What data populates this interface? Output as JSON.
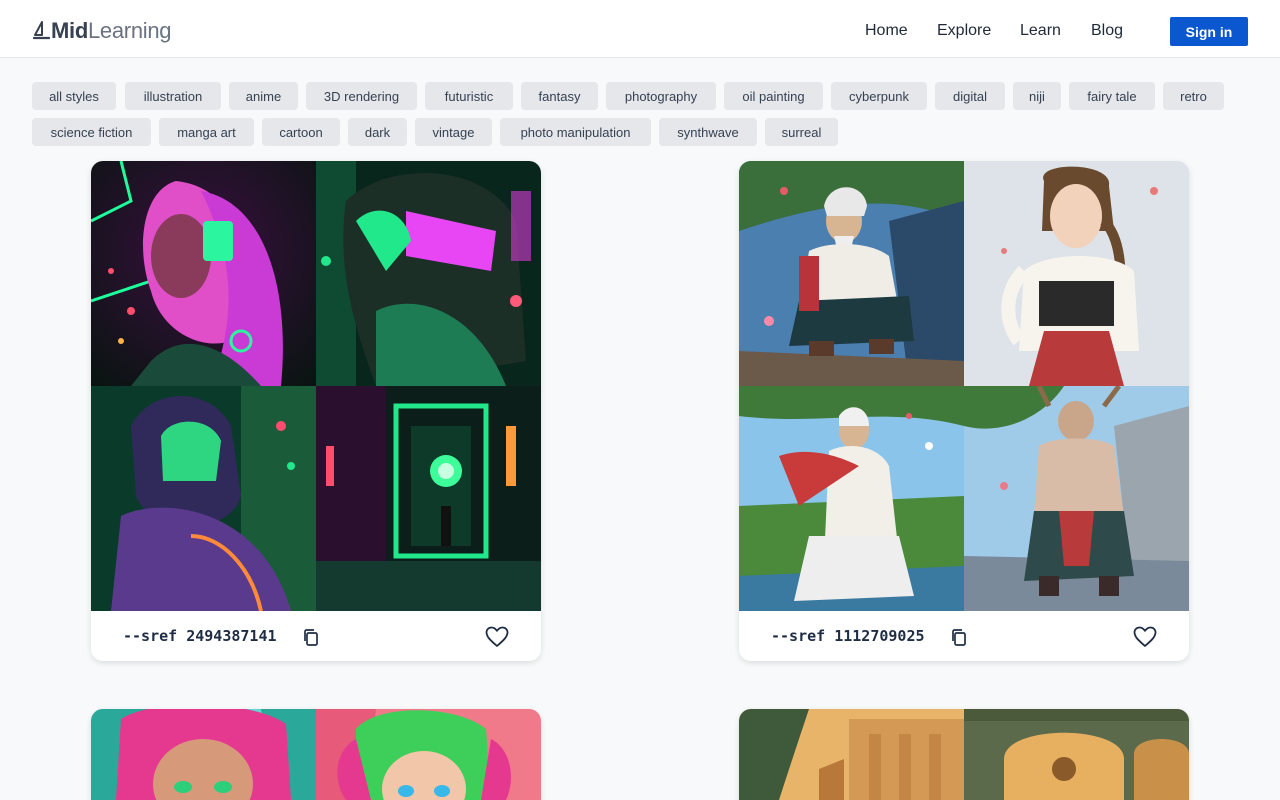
{
  "header": {
    "logo_mid": "Mid",
    "logo_learning": "Learning",
    "nav": [
      "Home",
      "Explore",
      "Learn",
      "Blog"
    ],
    "signin_label": "Sign in"
  },
  "tags": [
    "all styles",
    "illustration",
    "anime",
    "3D rendering",
    "futuristic",
    "fantasy",
    "photography",
    "oil painting",
    "cyberpunk",
    "digital",
    "niji",
    "fairy tale",
    "retro",
    "science fiction",
    "manga art",
    "cartoon",
    "dark",
    "vintage",
    "photo manipulation",
    "synthwave",
    "surreal"
  ],
  "cards": [
    {
      "sref": "--sref 2494387141",
      "image_theme": "neon cyberpunk portraits"
    },
    {
      "sref": "--sref 1112709025",
      "image_theme": "anime fantasy warriors"
    },
    {
      "image_theme": "cartoon girls with pigtails"
    },
    {
      "image_theme": "retro warm architecture"
    }
  ],
  "icons": {
    "copy": "copy-icon",
    "heart": "heart-icon",
    "logo": "sailboat-logo-icon"
  },
  "colors": {
    "accent": "#0b57d0",
    "tag_bg": "#e5e7eb",
    "page_bg": "#f8f9fa"
  }
}
